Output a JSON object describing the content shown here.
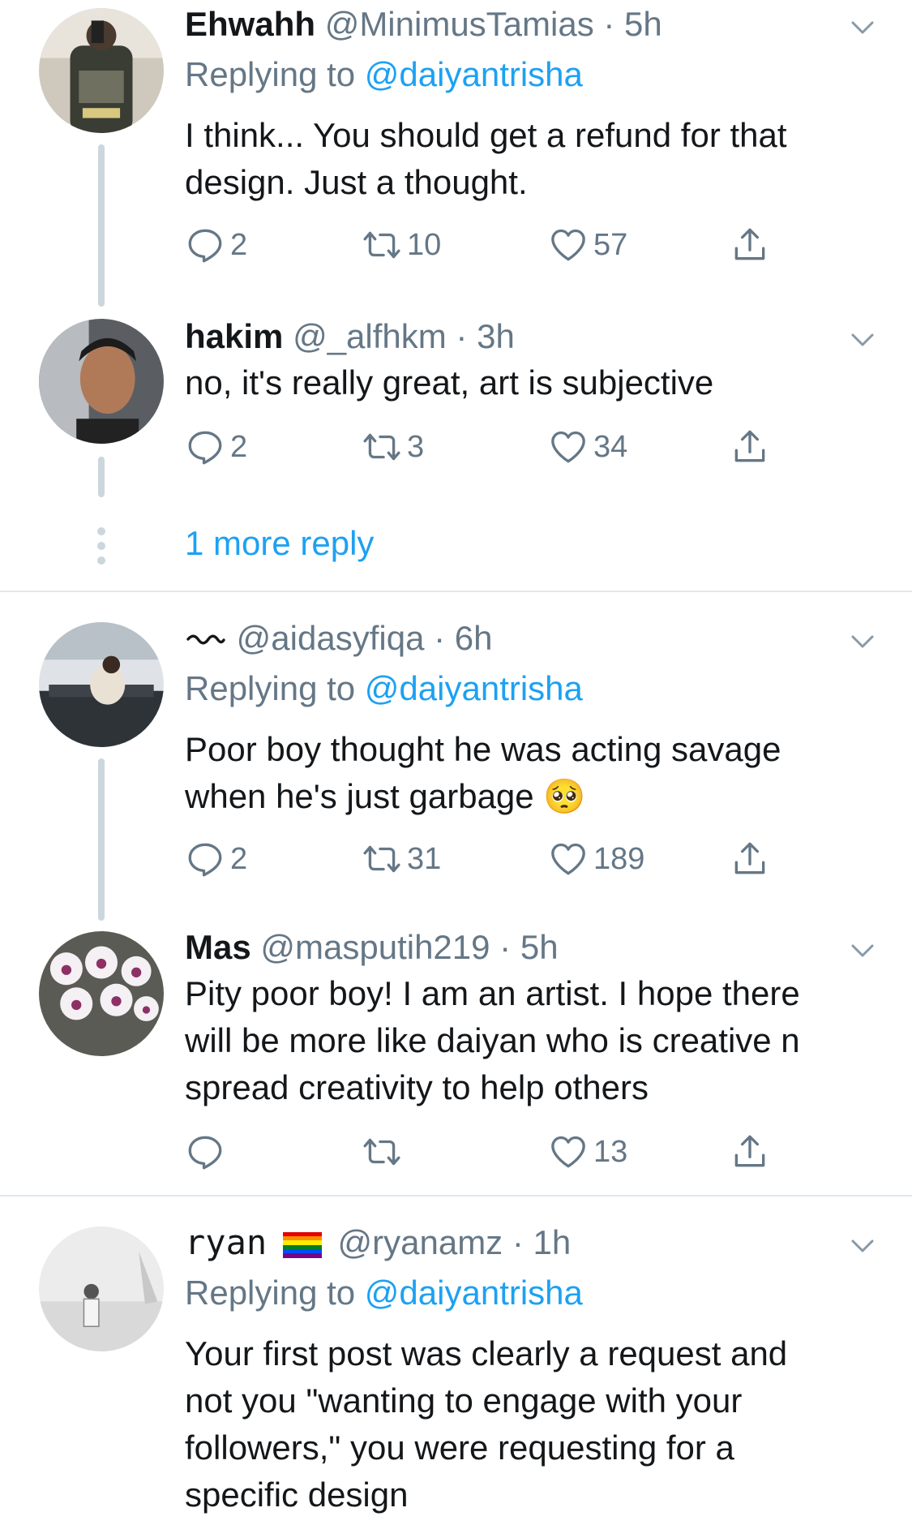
{
  "tweets": [
    {
      "name": "Ehwahh",
      "handle": "@MinimusTamias",
      "time": "5h",
      "replying_label": "Replying to ",
      "replying_to": "@daiyantrisha",
      "text_lines": [
        "I think... You should get a refund for that",
        "design. Just a thought."
      ],
      "replies": "2",
      "retweets": "10",
      "likes": "57"
    },
    {
      "name": "hakim",
      "handle": "@_alfhkm",
      "time": "3h",
      "text_lines": [
        "no, it's really great, art is subjective"
      ],
      "replies": "2",
      "retweets": "3",
      "likes": "34"
    },
    {
      "name": "",
      "name_icon": "tilde-wave-icon",
      "handle": "@aidasyfiqa",
      "time": "6h",
      "replying_label": "Replying to ",
      "replying_to": "@daiyantrisha",
      "text_lines": [
        "Poor boy thought he was acting savage",
        "when he's just garbage 🥺"
      ],
      "replies": "2",
      "retweets": "31",
      "likes": "189"
    },
    {
      "name": "Mas",
      "handle": "@masputih219",
      "time": "5h",
      "text_lines": [
        "Pity poor boy! I am an artist. I hope there",
        "will be more like daiyan who is creative n",
        "spread creativity to help others"
      ],
      "replies": "",
      "retweets": "",
      "likes": "13"
    },
    {
      "name": "ryan",
      "name_icon": "rainbow-flag-icon",
      "handle": "@ryanamz",
      "time": "1h",
      "replying_label": "Replying to ",
      "replying_to": "@daiyantrisha",
      "text_lines": [
        "Your first post was clearly a request and",
        "not you \"wanting to engage with your",
        "followers,\" you were requesting for a",
        "specific design"
      ]
    }
  ],
  "more_reply_label": "1 more reply",
  "separator": " · ",
  "colors": {
    "link": "#1da1f2",
    "meta": "#657786",
    "thread_line": "#ccd6dd",
    "divider": "#e1e8ed"
  }
}
